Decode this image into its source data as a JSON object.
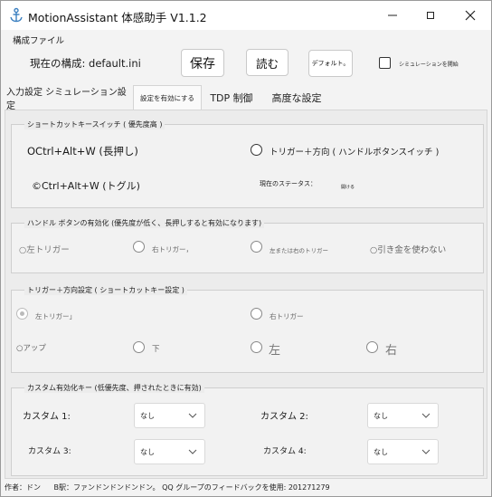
{
  "window": {
    "title": "MotionAssistant 体感助手 V1.1.2"
  },
  "config": {
    "section_label": "構成ファイル",
    "current_config_label": "現在の構成: default.ini",
    "save_label": "保存",
    "load_label": "読む",
    "default_label": "デフォルト。",
    "simulation_label": "シミュレーションを開始"
  },
  "tabs": [
    {
      "label": "入力設定 シミュレーション設定"
    },
    {
      "label": "設定を有効にする"
    },
    {
      "label": "TDP 制御"
    },
    {
      "label": "高度な設定"
    }
  ],
  "shortcut_group": {
    "title": "ショートカットキースイッチ ( 優先度高 )",
    "hold_label": "OCtrl+Alt+W (長押し)",
    "toggle_label": "©Ctrl+Alt+W (トグル)",
    "trigger_dir_label": "トリガー＋方向 ( ハンドルボタンスイッチ )",
    "status_label": "現在のステータス：",
    "status_value": "開ける"
  },
  "handle_group": {
    "title": "ハンドル ボタンの有効化 (優先度が低く、長押しすると有効になります)",
    "options": [
      "○左トリガー",
      "右トリガー，",
      "左または右のトリガー",
      "○引き金を使わない"
    ]
  },
  "trigger_dir_group": {
    "title": "トリガー＋方向設定 ( ショートカットキー設定 )",
    "left_trigger": "左トリガー」",
    "right_trigger": "右トリガー",
    "up": "○アップ",
    "down": "下",
    "left": "左",
    "right": "右"
  },
  "custom_group": {
    "title": "カスタム有効化キー (低優先度、押されたときに有効)",
    "custom1_label": "カスタム 1:",
    "custom2_label": "カスタム 2:",
    "custom3_label": "カスタム 3:",
    "custom4_label": "カスタム 4:",
    "custom1_value": "なし",
    "custom2_value": "なし",
    "custom3_value": "なし",
    "custom4_value": "なし"
  },
  "status_bar": {
    "author": "作者：ドン",
    "info": "B駅：ファンドンドンドンドン。 QQ グループのフィードバックを使用: 201271279"
  }
}
